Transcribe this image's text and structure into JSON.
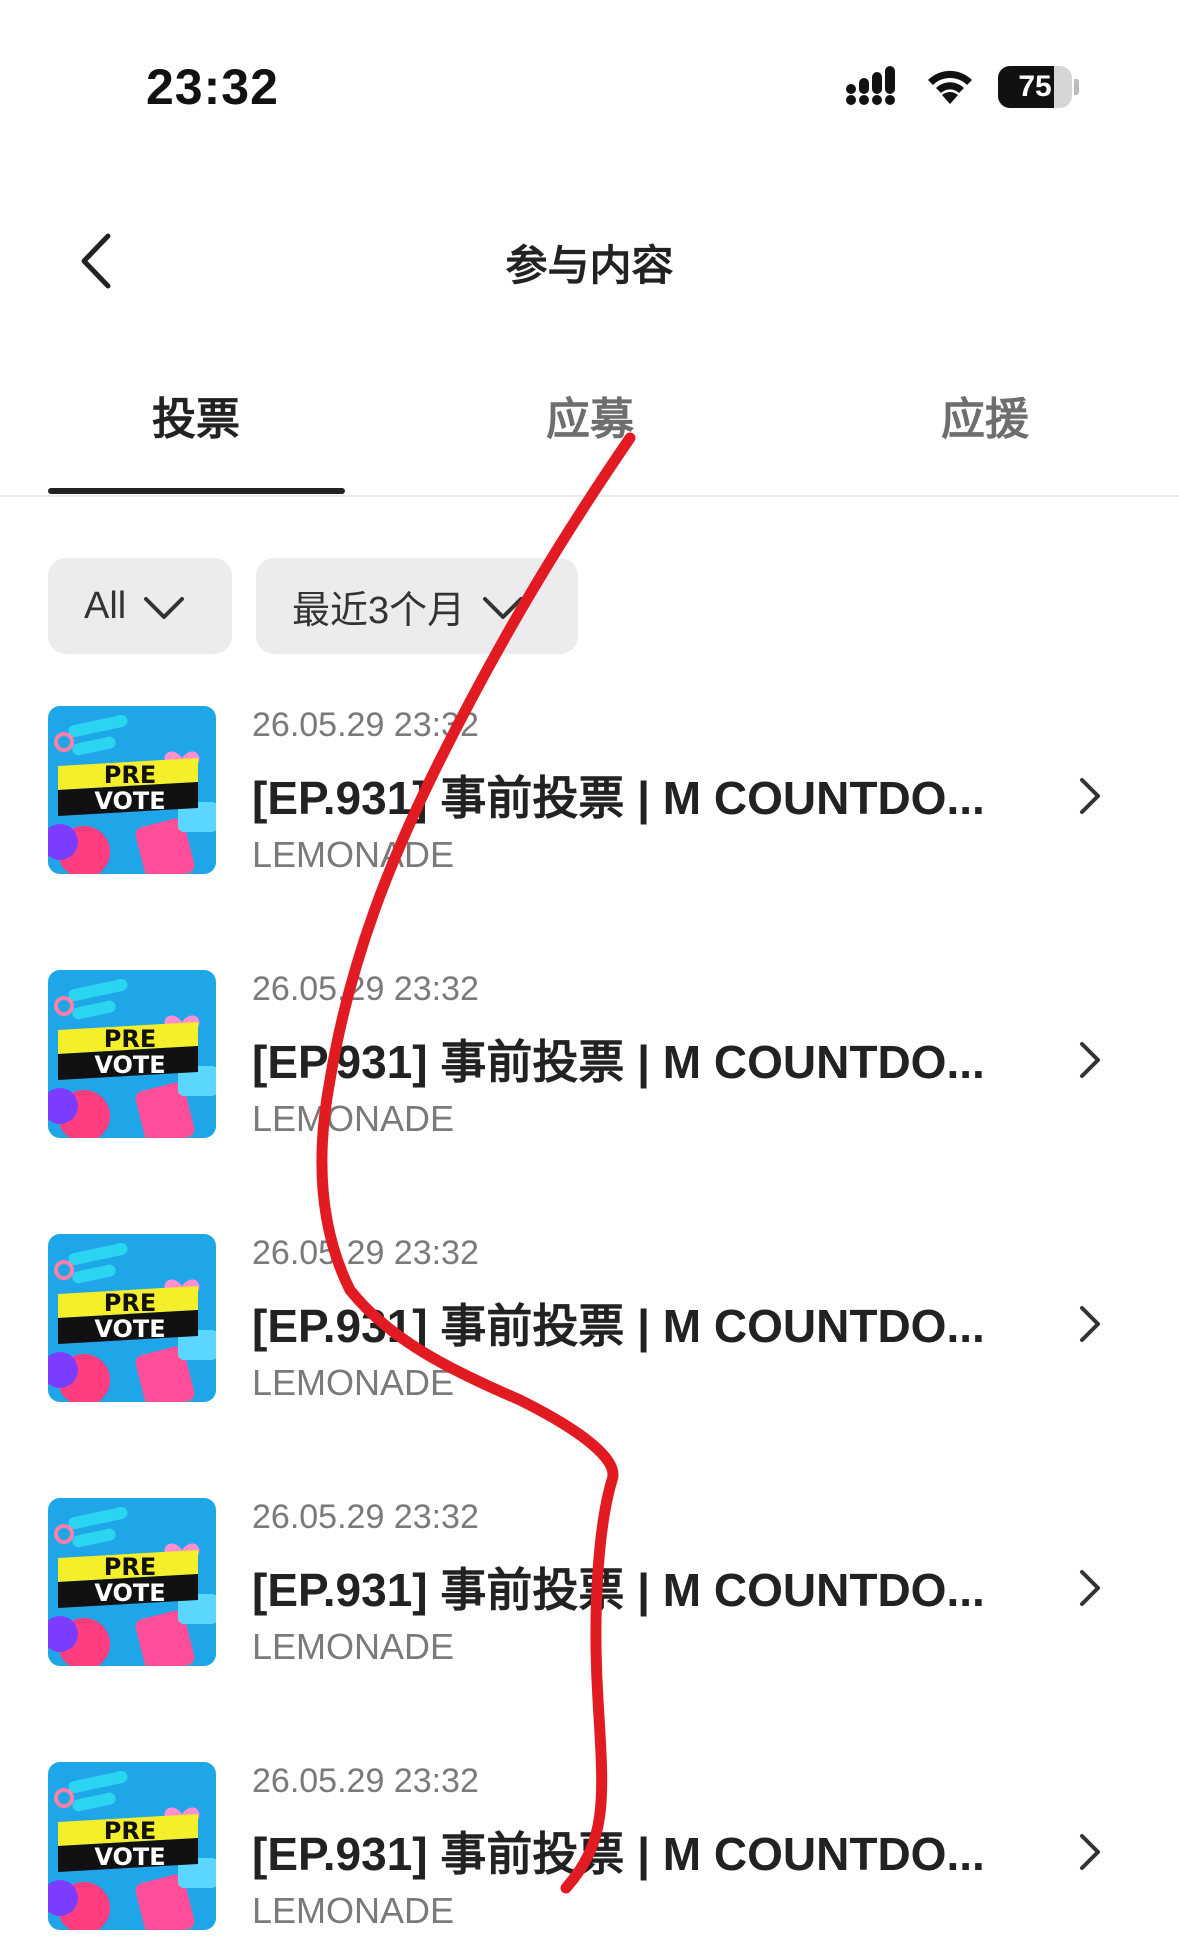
{
  "status_bar": {
    "time": "23:32",
    "battery": "75",
    "battery_level_percent": 75,
    "icons": [
      "signal-icon",
      "wifi-icon",
      "battery-icon"
    ]
  },
  "header": {
    "title": "参与内容",
    "back_icon": "chevron-left-icon"
  },
  "tabs": [
    {
      "label": "投票",
      "active": true
    },
    {
      "label": "应募",
      "active": false
    },
    {
      "label": "应援",
      "active": false
    }
  ],
  "filters": {
    "category": "All",
    "period": "最近3个月"
  },
  "items": [
    {
      "thumb_top": "PRE",
      "thumb_bottom": "VOTE",
      "date": "26.05.29 23:32",
      "title": "[EP.931] 事前投票 | M COUNTDO...",
      "subtitle": "LEMONADE"
    },
    {
      "thumb_top": "PRE",
      "thumb_bottom": "VOTE",
      "date": "26.05.29 23:32",
      "title": "[EP.931] 事前投票 | M COUNTDO...",
      "subtitle": "LEMONADE"
    },
    {
      "thumb_top": "PRE",
      "thumb_bottom": "VOTE",
      "date": "26.05.29 23:32",
      "title": "[EP.931] 事前投票 | M COUNTDO...",
      "subtitle": "LEMONADE"
    },
    {
      "thumb_top": "PRE",
      "thumb_bottom": "VOTE",
      "date": "26.05.29 23:32",
      "title": "[EP.931] 事前投票 | M COUNTDO...",
      "subtitle": "LEMONADE"
    },
    {
      "thumb_top": "PRE",
      "thumb_bottom": "VOTE",
      "date": "26.05.29 23:32",
      "title": "[EP.931] 事前投票 | M COUNTDO...",
      "subtitle": "LEMONADE"
    }
  ],
  "colors": {
    "scribble": "#e21b23",
    "thumb_background": "#1fa6e8",
    "thumb_banner": "#f5ee2a"
  }
}
